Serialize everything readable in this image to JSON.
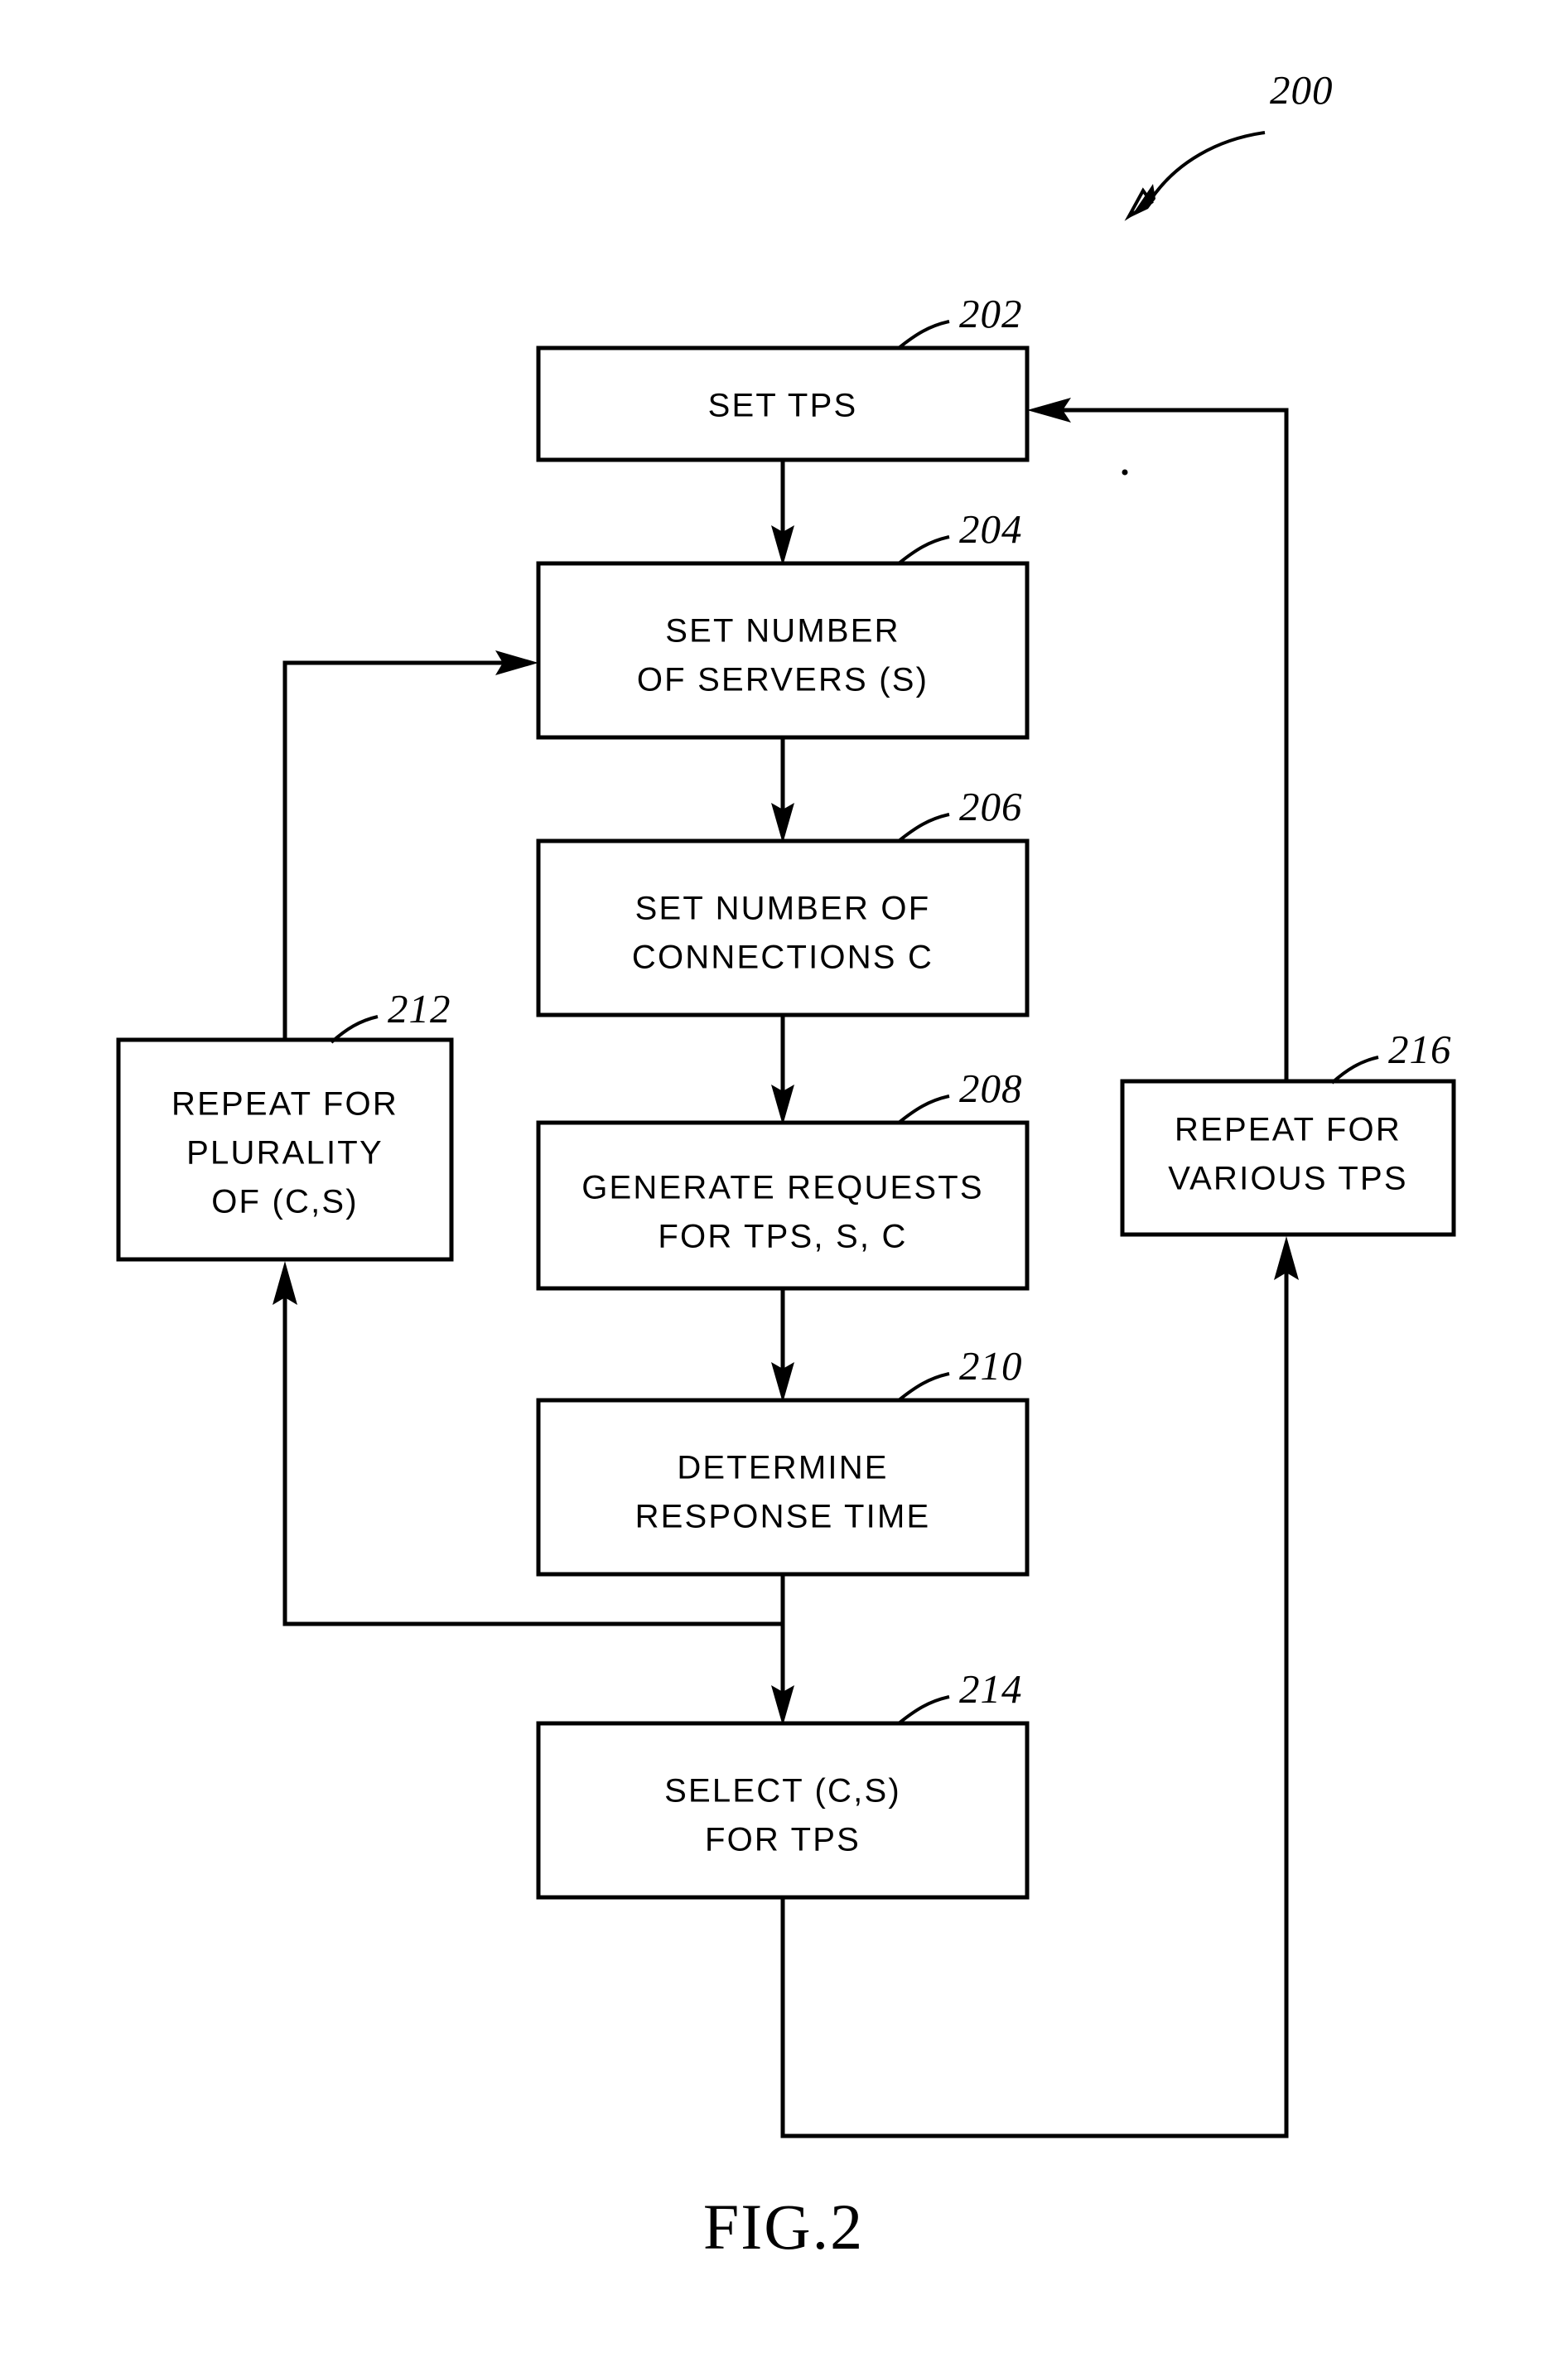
{
  "figure": {
    "caption": "FIG.2",
    "diagram_ref": "200",
    "type": "flowchart"
  },
  "nodes": {
    "n202": {
      "ref": "202",
      "lines": [
        "SET TPS"
      ]
    },
    "n204": {
      "ref": "204",
      "lines": [
        "SET NUMBER",
        "OF SERVERS (S)"
      ]
    },
    "n206": {
      "ref": "206",
      "lines": [
        "SET NUMBER OF",
        "CONNECTIONS C"
      ]
    },
    "n208": {
      "ref": "208",
      "lines": [
        "GENERATE REQUESTS",
        "FOR TPS, S, C"
      ]
    },
    "n210": {
      "ref": "210",
      "lines": [
        "DETERMINE",
        "RESPONSE TIME"
      ]
    },
    "n212": {
      "ref": "212",
      "lines": [
        "REPEAT FOR",
        "PLURALITY",
        "OF (C,S)"
      ]
    },
    "n214": {
      "ref": "214",
      "lines": [
        "SELECT (C,S)",
        "FOR TPS"
      ]
    },
    "n216": {
      "ref": "216",
      "lines": [
        "REPEAT FOR",
        "VARIOUS TPS"
      ]
    }
  },
  "flow": {
    "edges": [
      {
        "from": "n202",
        "to": "n204",
        "label": ""
      },
      {
        "from": "n204",
        "to": "n206",
        "label": ""
      },
      {
        "from": "n206",
        "to": "n208",
        "label": ""
      },
      {
        "from": "n208",
        "to": "n210",
        "label": ""
      },
      {
        "from": "n210",
        "to": "n214",
        "label": ""
      },
      {
        "from": "n210",
        "to": "n212",
        "label": ""
      },
      {
        "from": "n212",
        "to": "n204",
        "label": ""
      },
      {
        "from": "n214",
        "to": "n216",
        "label": ""
      },
      {
        "from": "n216",
        "to": "n202",
        "label": ""
      }
    ]
  },
  "style": {
    "ink": "#000000",
    "paper": "#ffffff"
  }
}
